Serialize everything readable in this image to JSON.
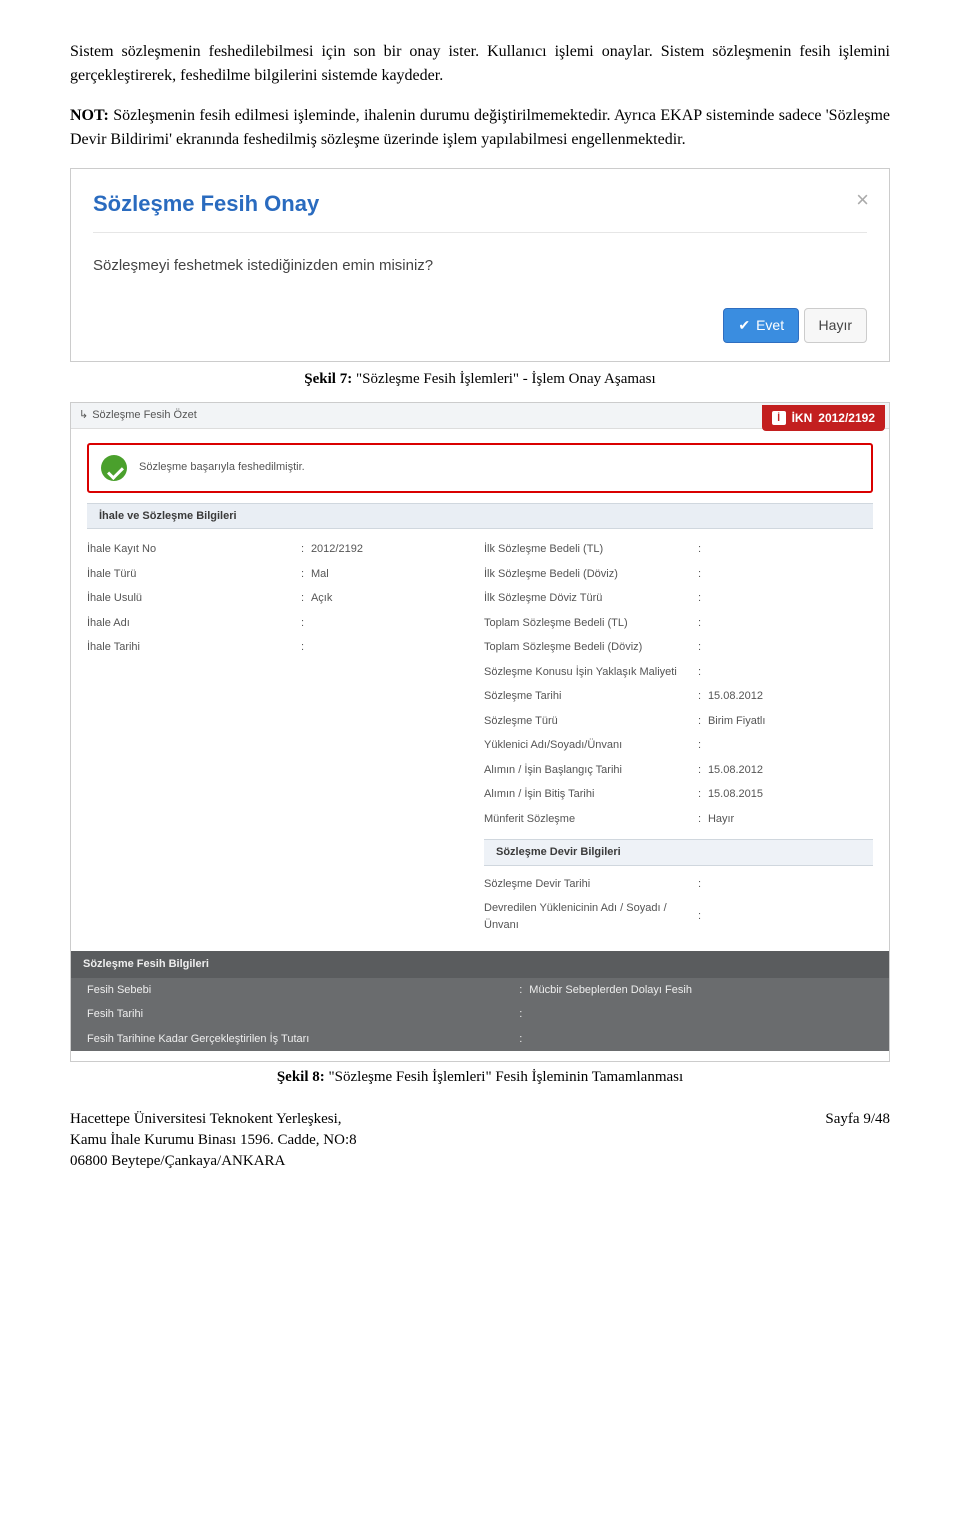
{
  "para1": "Sistem sözleşmenin feshedilebilmesi için son bir onay ister. Kullanıcı işlemi onaylar. Sistem sözleşmenin fesih işlemini gerçekleştirerek, feshedilme bilgilerini sistemde kaydeder.",
  "para2_label": "NOT:",
  "para2_text": " Sözleşmenin fesih edilmesi işleminde, ihalenin durumu değiştirilmemektedir. Ayrıca EKAP sisteminde sadece 'Sözleşme Devir Bildirimi' ekranında feshedilmiş sözleşme üzerinde işlem yapılabilmesi engellenmektedir.",
  "modal": {
    "title": "Sözleşme Fesih Onay",
    "body": "Sözleşmeyi feshetmek istediğinizden emin misiniz?",
    "yes": "Evet",
    "no": "Hayır"
  },
  "caption7_label": "Şekil 7:",
  "caption7_text": " \"Sözleşme Fesih İşlemleri\" - İşlem Onay Aşaması",
  "app": {
    "breadcrumb": "Sözleşme Fesih Özet",
    "ikn_label": "İKN",
    "ikn_value": "2012/2192",
    "notice": "Sözleşme başarıyla feshedilmiştir.",
    "section1": "İhale ve Sözleşme Bilgileri",
    "left": [
      {
        "label": "İhale Kayıt No",
        "value": "2012/2192"
      },
      {
        "label": "İhale Türü",
        "value": "Mal"
      },
      {
        "label": "İhale Usulü",
        "value": "Açık"
      },
      {
        "label": "İhale Adı",
        "value": ""
      },
      {
        "label": "İhale Tarihi",
        "value": ""
      }
    ],
    "right": [
      {
        "label": "İlk Sözleşme Bedeli (TL)",
        "value": ""
      },
      {
        "label": "İlk Sözleşme Bedeli (Döviz)",
        "value": ""
      },
      {
        "label": "İlk Sözleşme Döviz Türü",
        "value": ""
      },
      {
        "label": "Toplam Sözleşme Bedeli (TL)",
        "value": ""
      },
      {
        "label": "Toplam Sözleşme Bedeli (Döviz)",
        "value": ""
      },
      {
        "label": "Sözleşme Konusu İşin Yaklaşık Maliyeti",
        "value": ""
      },
      {
        "label": "Sözleşme Tarihi",
        "value": "15.08.2012"
      },
      {
        "label": "Sözleşme Türü",
        "value": "Birim Fiyatlı"
      },
      {
        "label": "Yüklenici Adı/Soyadı/Ünvanı",
        "value": ""
      },
      {
        "label": "Alımın / İşin Başlangıç Tarihi",
        "value": "15.08.2012"
      },
      {
        "label": "Alımın / İşin Bitiş Tarihi",
        "value": "15.08.2015"
      },
      {
        "label": "Münferit Sözleşme",
        "value": "Hayır"
      }
    ],
    "devir_header": "Sözleşme Devir Bilgileri",
    "devir": [
      {
        "label": "Sözleşme Devir Tarihi",
        "value": ""
      },
      {
        "label": "Devredilen Yüklenicinin Adı / Soyadı / Ünvanı",
        "value": ""
      }
    ],
    "fesih_header": "Sözleşme Fesih Bilgileri",
    "fesih": [
      {
        "label": "Fesih Sebebi",
        "value": "Mücbir Sebeplerden Dolayı Fesih"
      },
      {
        "label": "Fesih Tarihi",
        "value": ""
      },
      {
        "label": "Fesih Tarihine Kadar Gerçekleştirilen İş Tutarı",
        "value": ""
      }
    ]
  },
  "caption8_label": "Şekil 8:",
  "caption8_text": " \"Sözleşme Fesih İşlemleri\" Fesih İşleminin Tamamlanması",
  "footer": {
    "l1": "Hacettepe Üniversitesi Teknokent Yerleşkesi,",
    "l2": "Kamu İhale Kurumu Binası 1596. Cadde, NO:8",
    "l3": "06800 Beytepe/Çankaya/ANKARA",
    "page": "Sayfa 9/48"
  }
}
